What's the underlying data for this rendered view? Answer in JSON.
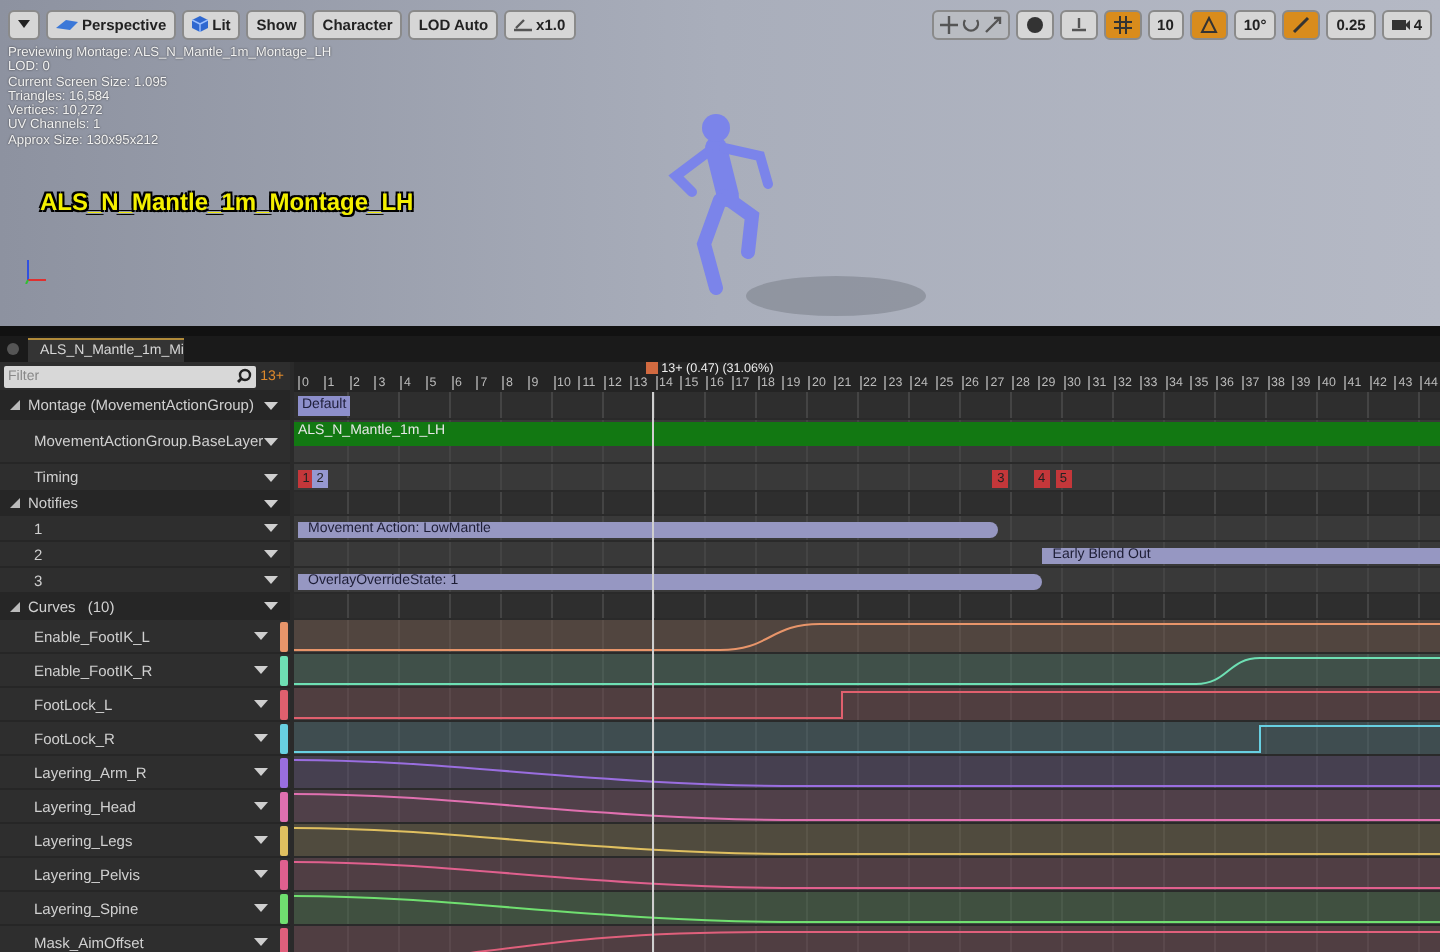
{
  "viewport": {
    "toolbar": [
      {
        "kind": "perspective",
        "label": "Perspective"
      },
      {
        "kind": "lit",
        "label": "Lit"
      },
      {
        "kind": "plain",
        "label": "Show"
      },
      {
        "kind": "plain",
        "label": "Character"
      },
      {
        "kind": "plain",
        "label": "LOD Auto"
      },
      {
        "kind": "speed",
        "label": "x1.0"
      }
    ],
    "snap_controls": [
      {
        "kind": "grid",
        "on": true,
        "value": "10"
      },
      {
        "kind": "rotation",
        "on": true,
        "value": "10°"
      },
      {
        "kind": "scale",
        "on": true,
        "value": "0.25"
      }
    ],
    "camera_speed": "4",
    "info_lines": [
      "Previewing Montage: ALS_N_Mantle_1m_Montage_LH",
      "LOD: 0",
      "Current Screen Size: 1.095",
      "Triangles: 16,584",
      "Vertices: 10,272",
      "UV Channels: 1",
      "Approx Size: 130x95x212"
    ],
    "asset_title": "ALS_N_Mantle_1m_Montage_LH"
  },
  "tab": {
    "label": "ALS_N_Mantle_1m_Mi"
  },
  "sequencer": {
    "filter": {
      "placeholder": "Filter"
    },
    "current_frame": "13+",
    "playhead_label": "13+ (0.47) (31.06%)",
    "ticks": [
      "0",
      "1",
      "2",
      "3",
      "4",
      "5",
      "6",
      "7",
      "8",
      "9",
      "10",
      "11",
      "12",
      "13",
      "14",
      "15",
      "16",
      "17",
      "18",
      "19",
      "20",
      "21",
      "22",
      "23",
      "24",
      "25",
      "26",
      "27",
      "28",
      "29",
      "30",
      "31",
      "32",
      "33",
      "34",
      "35",
      "36",
      "37",
      "38",
      "39",
      "40",
      "41",
      "42",
      "43",
      "44"
    ],
    "montage": {
      "label": "Montage (MovementActionGroup)",
      "expanded": true,
      "section_label": "Default",
      "slot": {
        "label": "MovementActionGroup.BaseLayer",
        "segment": "ALS_N_Mantle_1m_LH"
      },
      "timing": {
        "label": "Timing",
        "markers": [
          {
            "label": "1",
            "kind": "section"
          },
          {
            "label": "2",
            "kind": "notify"
          },
          {
            "label": "3",
            "kind": "section"
          },
          {
            "label": "4",
            "kind": "section"
          },
          {
            "label": "5",
            "kind": "section"
          }
        ]
      }
    },
    "notifies": {
      "label": "Notifies",
      "expanded": true,
      "tracks": [
        {
          "label": "1",
          "notifies": [
            {
              "label": "Movement Action: LowMantle"
            }
          ]
        },
        {
          "label": "2",
          "notifies": [
            {
              "label": "Early Blend Out"
            }
          ]
        },
        {
          "label": "3",
          "notifies": [
            {
              "label": "OverlayOverrideState: 1"
            }
          ]
        }
      ]
    },
    "curves": {
      "label": "Curves",
      "count": "(10)",
      "expanded": true,
      "items": [
        {
          "name": "Enable_FootIK_L",
          "color": "#e8956a"
        },
        {
          "name": "Enable_FootIK_R",
          "color": "#6ee0b4"
        },
        {
          "name": "FootLock_L",
          "color": "#e0606e"
        },
        {
          "name": "FootLock_R",
          "color": "#68d0e2"
        },
        {
          "name": "Layering_Arm_R",
          "color": "#9a6ee0"
        },
        {
          "name": "Layering_Head",
          "color": "#e070b0"
        },
        {
          "name": "Layering_Legs",
          "color": "#e0c060"
        },
        {
          "name": "Layering_Pelvis",
          "color": "#e0608e"
        },
        {
          "name": "Layering_Spine",
          "color": "#70e070"
        },
        {
          "name": "Mask_AimOffset",
          "color": "#e0607c"
        }
      ]
    }
  }
}
